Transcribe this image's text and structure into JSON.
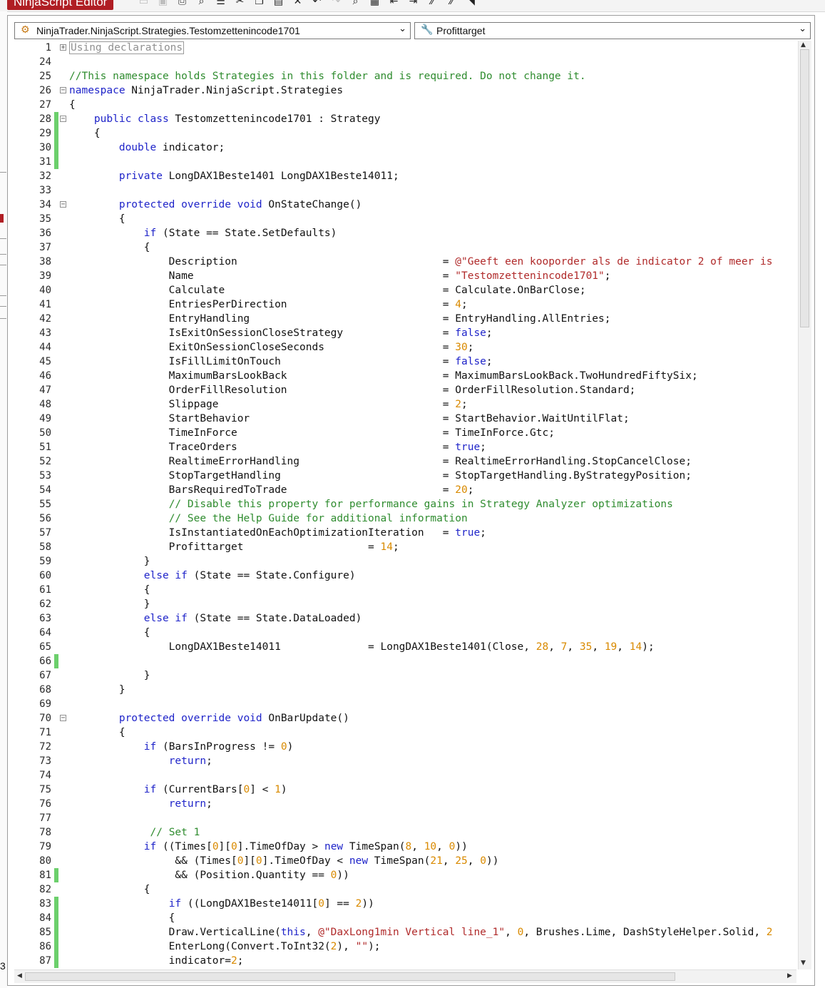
{
  "app_title": "NinjaScript Editor",
  "toolbar": {
    "icons": [
      "new-file-icon",
      "save-icon",
      "print-icon",
      "print-preview-icon",
      "properties-icon",
      "cut-icon",
      "copy-icon",
      "paste-icon",
      "delete-icon",
      "undo-icon",
      "redo-icon",
      "find-icon",
      "calculator-icon",
      "outdent-icon",
      "indent-icon",
      "comment-icon",
      "uncomment-icon",
      "visual-studio-icon"
    ]
  },
  "class_dropdown": {
    "value": "NinjaTrader.NinjaScript.Strategies.Testomzettenincode1701"
  },
  "member_dropdown": {
    "value": "Profittarget"
  },
  "edge_digit": "3",
  "code_lines": [
    {
      "n": "1",
      "html": "<span class=\"bx\">Using declarations</span>"
    },
    {
      "n": "24",
      "html": ""
    },
    {
      "n": "25",
      "html": "<span class=\"c\">//This namespace holds Strategies in this folder and is required. Do not change it.</span>"
    },
    {
      "n": "26",
      "html": "<span class=\"k\">namespace</span> NinjaTrader.NinjaScript.Strategies"
    },
    {
      "n": "27",
      "html": "{"
    },
    {
      "n": "28",
      "html": "    <span class=\"k\">public class</span> Testomzettenincode1701 : Strategy"
    },
    {
      "n": "29",
      "html": "    {"
    },
    {
      "n": "30",
      "html": "        <span class=\"k\">double</span> indicator;"
    },
    {
      "n": "31",
      "html": ""
    },
    {
      "n": "32",
      "html": "        <span class=\"k\">private</span> LongDAX1Beste1401 LongDAX1Beste14011;"
    },
    {
      "n": "33",
      "html": ""
    },
    {
      "n": "34",
      "html": "        <span class=\"k\">protected override void</span> OnStateChange()"
    },
    {
      "n": "35",
      "html": "        {"
    },
    {
      "n": "36",
      "html": "            <span class=\"k\">if</span> (State == State.SetDefaults)"
    },
    {
      "n": "37",
      "html": "            {"
    },
    {
      "n": "38",
      "html": "                Description                                 = <span class=\"s\">@\"Geeft een kooporder als de indicator 2 of meer is</span>"
    },
    {
      "n": "39",
      "html": "                Name                                        = <span class=\"s\">\"Testomzettenincode1701\"</span>;"
    },
    {
      "n": "40",
      "html": "                Calculate                                   = Calculate.OnBarClose;"
    },
    {
      "n": "41",
      "html": "                EntriesPerDirection                         = <span class=\"n\">4</span>;"
    },
    {
      "n": "42",
      "html": "                EntryHandling                               = EntryHandling.AllEntries;"
    },
    {
      "n": "43",
      "html": "                IsExitOnSessionCloseStrategy                = <span class=\"k\">false</span>;"
    },
    {
      "n": "44",
      "html": "                ExitOnSessionCloseSeconds                   = <span class=\"n\">30</span>;"
    },
    {
      "n": "45",
      "html": "                IsFillLimitOnTouch                          = <span class=\"k\">false</span>;"
    },
    {
      "n": "46",
      "html": "                MaximumBarsLookBack                         = MaximumBarsLookBack.TwoHundredFiftySix;"
    },
    {
      "n": "47",
      "html": "                OrderFillResolution                         = OrderFillResolution.Standard;"
    },
    {
      "n": "48",
      "html": "                Slippage                                    = <span class=\"n\">2</span>;"
    },
    {
      "n": "49",
      "html": "                StartBehavior                               = StartBehavior.WaitUntilFlat;"
    },
    {
      "n": "50",
      "html": "                TimeInForce                                 = TimeInForce.Gtc;"
    },
    {
      "n": "51",
      "html": "                TraceOrders                                 = <span class=\"k\">true</span>;"
    },
    {
      "n": "52",
      "html": "                RealtimeErrorHandling                       = RealtimeErrorHandling.StopCancelClose;"
    },
    {
      "n": "53",
      "html": "                StopTargetHandling                          = StopTargetHandling.ByStrategyPosition;"
    },
    {
      "n": "54",
      "html": "                BarsRequiredToTrade                         = <span class=\"n\">20</span>;"
    },
    {
      "n": "55",
      "html": "                <span class=\"c\">// Disable this property for performance gains in Strategy Analyzer optimizations</span>"
    },
    {
      "n": "56",
      "html": "                <span class=\"c\">// See the Help Guide for additional information</span>"
    },
    {
      "n": "57",
      "html": "                IsInstantiatedOnEachOptimizationIteration   = <span class=\"k\">true</span>;"
    },
    {
      "n": "58",
      "html": "                Profittarget                    = <span class=\"n\">14</span>;"
    },
    {
      "n": "59",
      "html": "            }"
    },
    {
      "n": "60",
      "html": "            <span class=\"k\">else if</span> (State == State.Configure)"
    },
    {
      "n": "61",
      "html": "            {"
    },
    {
      "n": "62",
      "html": "            }"
    },
    {
      "n": "63",
      "html": "            <span class=\"k\">else if</span> (State == State.DataLoaded)"
    },
    {
      "n": "64",
      "html": "            {"
    },
    {
      "n": "65",
      "html": "                LongDAX1Beste14011              = LongDAX1Beste1401(Close, <span class=\"n\">28</span>, <span class=\"n\">7</span>, <span class=\"n\">35</span>, <span class=\"n\">19</span>, <span class=\"n\">14</span>);"
    },
    {
      "n": "66",
      "html": ""
    },
    {
      "n": "67",
      "html": "            }"
    },
    {
      "n": "68",
      "html": "        }"
    },
    {
      "n": "69",
      "html": ""
    },
    {
      "n": "70",
      "html": "        <span class=\"k\">protected override void</span> OnBarUpdate()"
    },
    {
      "n": "71",
      "html": "        {"
    },
    {
      "n": "72",
      "html": "            <span class=\"k\">if</span> (BarsInProgress != <span class=\"n\">0</span>)"
    },
    {
      "n": "73",
      "html": "                <span class=\"k\">return</span>;"
    },
    {
      "n": "74",
      "html": ""
    },
    {
      "n": "75",
      "html": "            <span class=\"k\">if</span> (CurrentBars[<span class=\"n\">0</span>] &lt; <span class=\"n\">1</span>)"
    },
    {
      "n": "76",
      "html": "                <span class=\"k\">return</span>;"
    },
    {
      "n": "77",
      "html": ""
    },
    {
      "n": "78",
      "html": "             <span class=\"c\">// Set 1</span>"
    },
    {
      "n": "79",
      "html": "            <span class=\"k\">if</span> ((Times[<span class=\"n\">0</span>][<span class=\"n\">0</span>].TimeOfDay &gt; <span class=\"k\">new</span> TimeSpan(<span class=\"n\">8</span>, <span class=\"n\">10</span>, <span class=\"n\">0</span>))"
    },
    {
      "n": "80",
      "html": "                 &amp;&amp; (Times[<span class=\"n\">0</span>][<span class=\"n\">0</span>].TimeOfDay &lt; <span class=\"k\">new</span> TimeSpan(<span class=\"n\">21</span>, <span class=\"n\">25</span>, <span class=\"n\">0</span>))"
    },
    {
      "n": "81",
      "html": "                 &amp;&amp; (Position.Quantity == <span class=\"n\">0</span>))"
    },
    {
      "n": "82",
      "html": "            {"
    },
    {
      "n": "83",
      "html": "                <span class=\"k\">if</span> ((LongDAX1Beste14011[<span class=\"n\">0</span>] == <span class=\"n\">2</span>))"
    },
    {
      "n": "84",
      "html": "                {"
    },
    {
      "n": "85",
      "html": "                Draw.VerticalLine(<span class=\"k\">this</span>, <span class=\"s\">@\"DaxLong1min Vertical line_1\"</span>, <span class=\"n\">0</span>, Brushes.Lime, DashStyleHelper.Solid, <span class=\"n\">2</span>"
    },
    {
      "n": "86",
      "html": "                EnterLong(Convert.ToInt32(<span class=\"n\">2</span>), <span class=\"s\">\"\"</span>);"
    },
    {
      "n": "87",
      "html": "                indicator=<span class=\"n\">2</span>;"
    }
  ]
}
